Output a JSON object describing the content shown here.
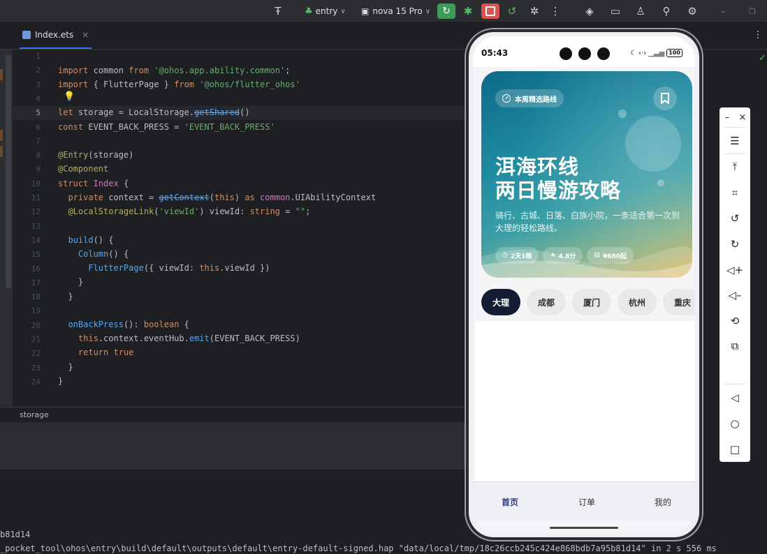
{
  "toolbar": {
    "module_label": "entry",
    "device_label": "nova 15 Pro"
  },
  "editor": {
    "tab_label": "Index.ets",
    "line_numbers": [
      "1",
      "2",
      "3",
      "4",
      "5",
      "6",
      "7",
      "8",
      "9",
      "10",
      "11",
      "12",
      "13",
      "14",
      "15",
      "16",
      "17",
      "18",
      "19",
      "20",
      "21",
      "22",
      "23",
      "24"
    ],
    "breadcrumb": "storage"
  },
  "console": {
    "line1": "b81d14",
    "line2": "_pocket_tool\\ohos\\entry\\build\\default\\outputs\\default\\entry-default-signed.hap \"data/local/tmp/18c26ccb245c424e868bdb7a95b81d14\" in 2 s 556 ms"
  },
  "phone": {
    "time": "05:43",
    "battery": "100",
    "hero": {
      "chip": "本周精选路线",
      "title_line1": "洱海环线",
      "title_line2": "两日慢游攻略",
      "subtitle": "骑行、古城、日落、白族小院，一条适合第一次到大理的轻松路线。",
      "stats": [
        "2天1晚",
        "4.8分",
        "¥680起"
      ]
    },
    "cities": [
      "大理",
      "成都",
      "厦门",
      "杭州",
      "重庆"
    ],
    "active_city": "大理",
    "bottom_tabs": [
      "首页",
      "订单",
      "我的"
    ],
    "active_tab": "首页"
  },
  "colors": {
    "accent": "#3574f0",
    "run_green": "#3f9c58",
    "stop_red": "#d9534f",
    "city_active": "#141d33",
    "tab_active": "#2b3d86"
  }
}
